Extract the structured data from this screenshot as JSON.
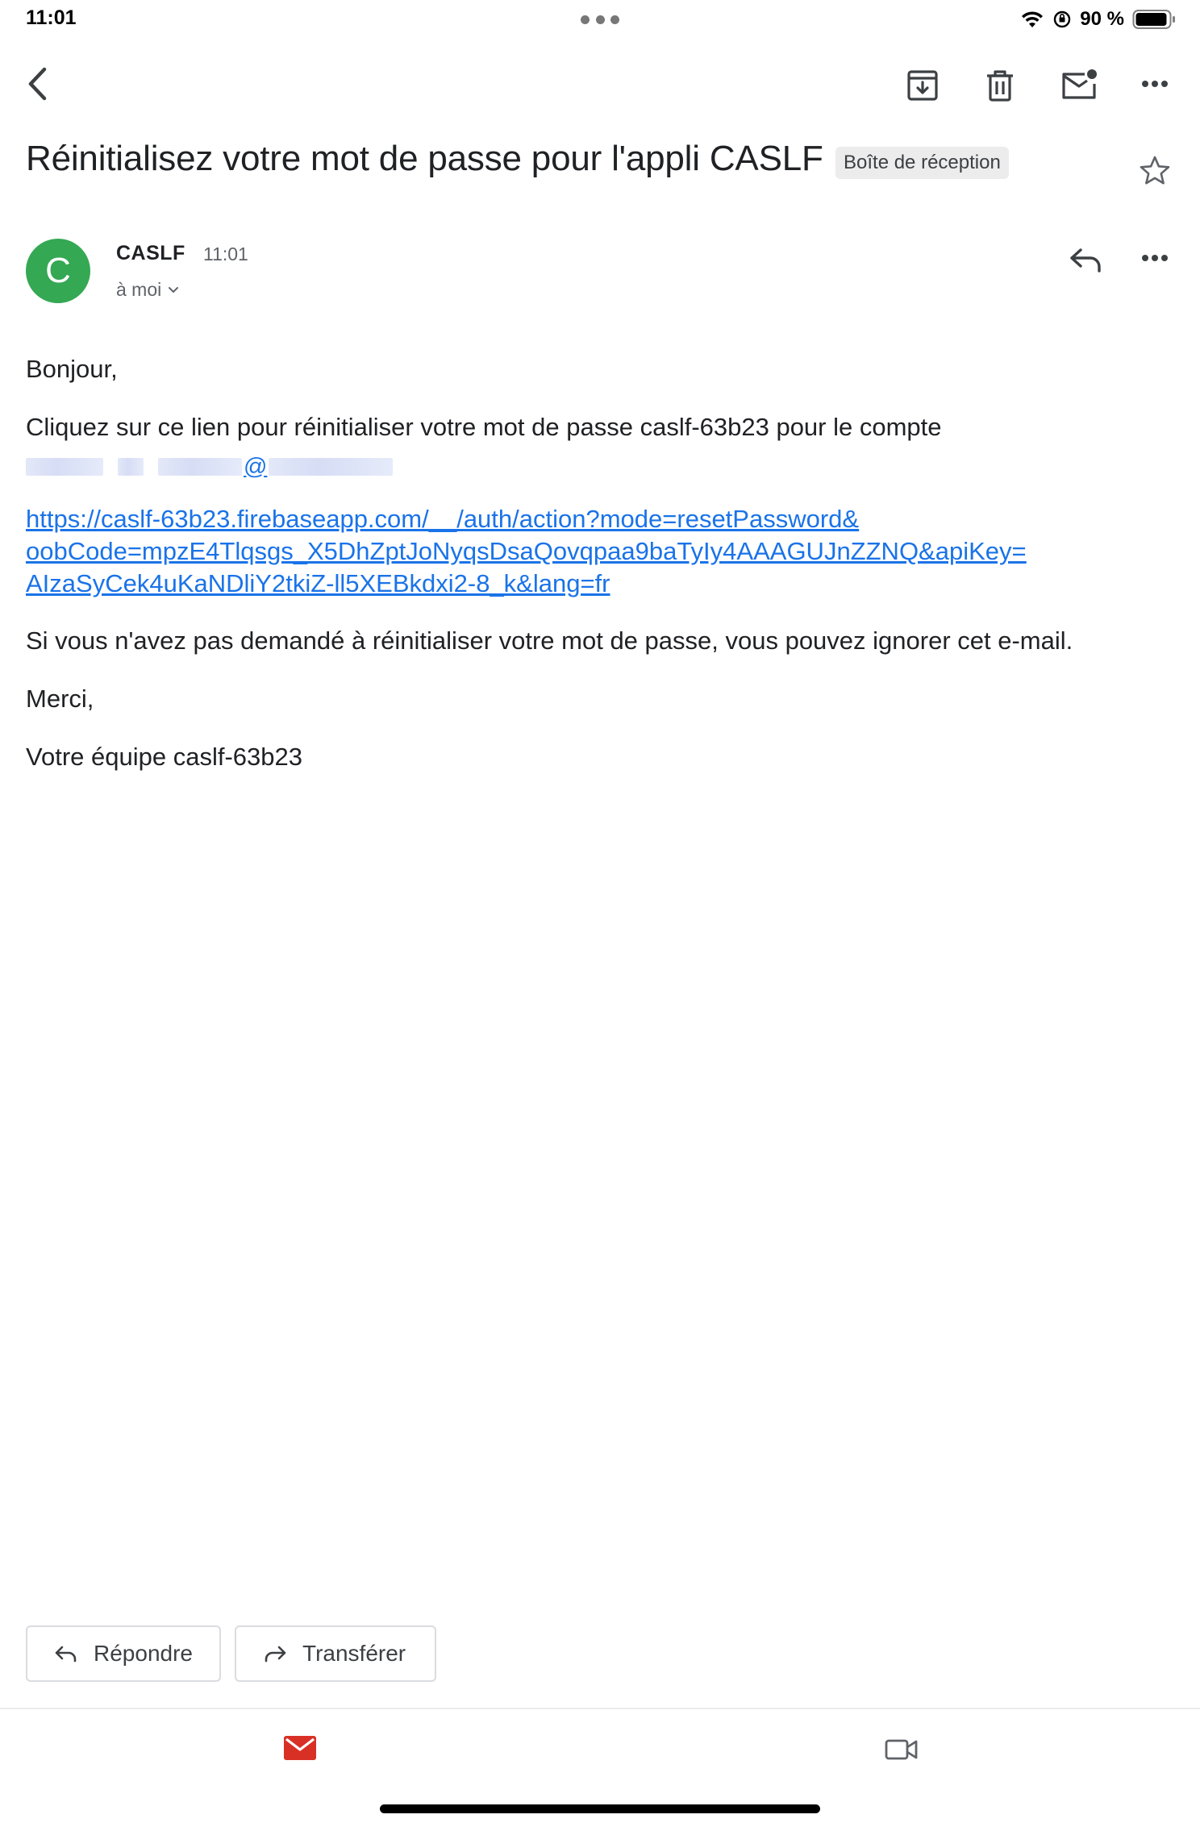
{
  "status_bar": {
    "time": "11:01",
    "battery_text": "90 %"
  },
  "toolbar": {
    "icons": [
      "back-icon",
      "archive-icon",
      "delete-icon",
      "mark-unread-icon",
      "more-icon"
    ]
  },
  "email": {
    "subject": "Réinitialisez votre mot de passe pour l'appli CASLF",
    "label": "Boîte de réception",
    "avatar_letter": "C",
    "sender_name": "CASLF",
    "time": "11:01",
    "recipient": "à moi",
    "greeting": "Bonjour,",
    "intro": "Cliquez sur ce lien pour réinitialiser votre mot de passe caslf-63b23 pour le compte",
    "email_at": "@",
    "link_lines": [
      "https://caslf-63b23.firebaseapp.com/__/auth/action?mode=resetPassword&",
      "oobCode=mpzE4Tlqsgs_X5DhZptJoNyqsDsaQovqpaa9baTyIy4AAAGUJnZZNQ&apiKey=",
      "AIzaSyCek4uKaNDliY2tkiZ-ll5XEBkdxi2-8_k&lang=fr"
    ],
    "ignore_text": "Si vous n'avez pas demandé à réinitialiser votre mot de passe, vous pouvez ignorer cet e-mail.",
    "thanks": "Merci,",
    "signature": "Votre équipe caslf-63b23"
  },
  "actions": {
    "reply_label": "Répondre",
    "forward_label": "Transférer"
  },
  "bottom_nav": {
    "items": [
      "mail-icon",
      "video-icon"
    ]
  }
}
